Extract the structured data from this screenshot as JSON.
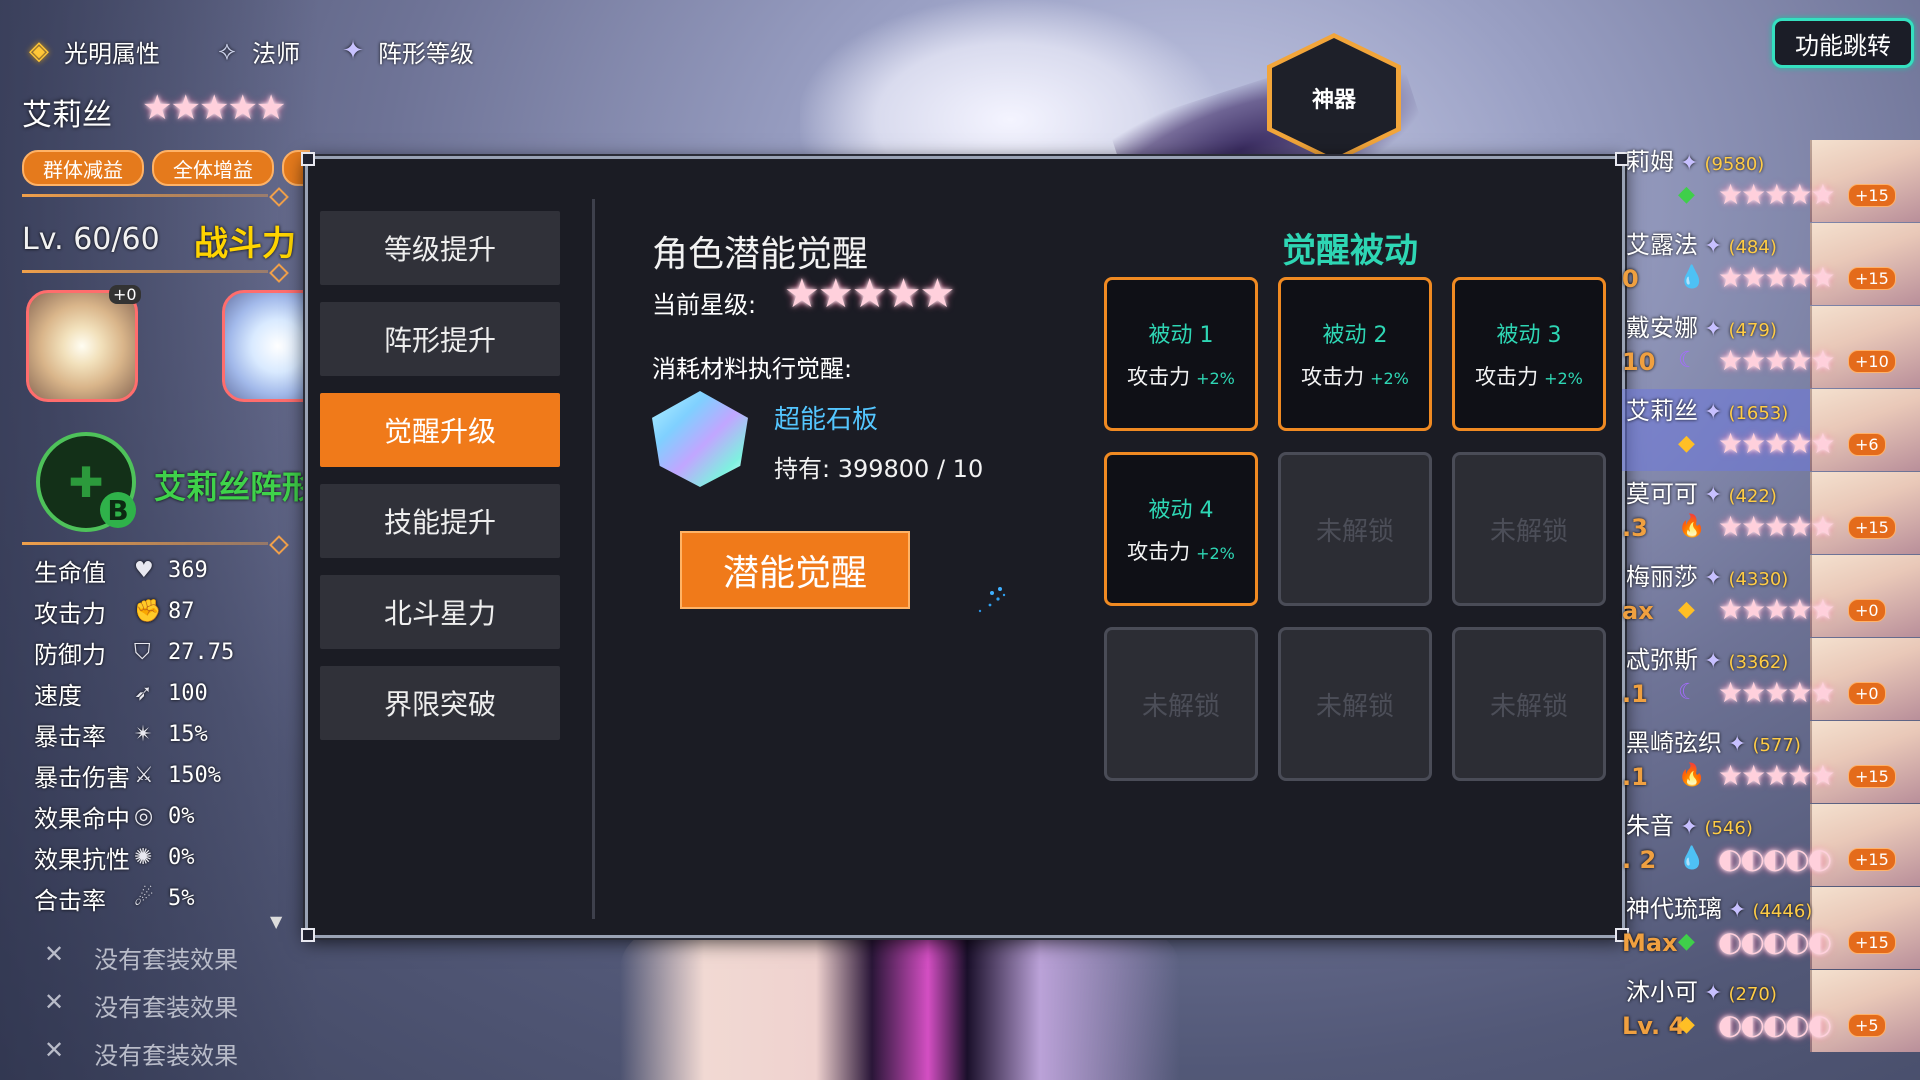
{
  "header": {
    "attribute_label": "光明属性",
    "class_label": "法师",
    "formation_label": "阵形等级",
    "switch_button": "功能跳转",
    "artifact_label": "神器"
  },
  "character": {
    "name": "艾莉丝",
    "stars": "★★★★★",
    "tags": [
      "群体减益",
      "全体增益"
    ],
    "level_text": "Lv. 60/60",
    "combat_label": "战斗力",
    "equip": [
      {
        "badge": "+0"
      },
      {
        "badge": ""
      }
    ],
    "formation_name": "艾莉丝阵形",
    "formation_grade": "B"
  },
  "stats": [
    {
      "label": "生命值",
      "icon": "heart-icon",
      "glyph": "♥",
      "value": "369"
    },
    {
      "label": "攻击力",
      "icon": "fist-icon",
      "glyph": "✊",
      "value": "87"
    },
    {
      "label": "防御力",
      "icon": "shield-icon",
      "glyph": "⛉",
      "value": "27.75"
    },
    {
      "label": "速度",
      "icon": "wing-icon",
      "glyph": "➶",
      "value": "100"
    },
    {
      "label": "暴击率",
      "icon": "crit-icon",
      "glyph": "✴",
      "value": "15%"
    },
    {
      "label": "暴击伤害",
      "icon": "crit-damage-icon",
      "glyph": "⚔",
      "value": "150%"
    },
    {
      "label": "效果命中",
      "icon": "target-icon",
      "glyph": "◎",
      "value": "0%"
    },
    {
      "label": "效果抗性",
      "icon": "resist-icon",
      "glyph": "✺",
      "value": "0%"
    },
    {
      "label": "合击率",
      "icon": "combo-icon",
      "glyph": "☄",
      "value": "5%"
    }
  ],
  "set_effects": [
    {
      "mark": "✕",
      "text": "没有套装效果"
    },
    {
      "mark": "✕",
      "text": "没有套装效果"
    },
    {
      "mark": "✕",
      "text": "没有套装效果"
    }
  ],
  "nav": [
    {
      "label": "等级提升",
      "active": false
    },
    {
      "label": "阵形提升",
      "active": false
    },
    {
      "label": "觉醒升级",
      "active": true
    },
    {
      "label": "技能提升",
      "active": false
    },
    {
      "label": "北斗星力",
      "active": false
    },
    {
      "label": "界限突破",
      "active": false
    }
  ],
  "awaken": {
    "title": "角色潜能觉醒",
    "current_star_label": "当前星级:",
    "current_stars": "★★★★★",
    "material_label": "消耗材料执行觉醒:",
    "material_name": "超能石板",
    "owned_text": "持有: 399800 / 10",
    "button": "潜能觉醒"
  },
  "passives": {
    "title": "觉醒被动",
    "cells": [
      {
        "name": "被动 1",
        "stat": "攻击力",
        "bonus": "+2%",
        "unlocked": true
      },
      {
        "name": "被动 2",
        "stat": "攻击力",
        "bonus": "+2%",
        "unlocked": true
      },
      {
        "name": "被动 3",
        "stat": "攻击力",
        "bonus": "+2%",
        "unlocked": true
      },
      {
        "name": "被动 4",
        "stat": "攻击力",
        "bonus": "+2%",
        "unlocked": true
      },
      {
        "locked_text": "未解锁",
        "unlocked": false
      },
      {
        "locked_text": "未解锁",
        "unlocked": false
      },
      {
        "locked_text": "未解锁",
        "unlocked": false
      },
      {
        "locked_text": "未解锁",
        "unlocked": false
      },
      {
        "locked_text": "未解锁",
        "unlocked": false
      }
    ]
  },
  "roster": [
    {
      "name": "莉姆",
      "power": "(9580)",
      "lv": "",
      "elem": "◆",
      "elem_color": "#3fcf4a",
      "stars": "★★★★★",
      "plus": "+15",
      "selected": false
    },
    {
      "name": "艾露法",
      "power": "(484)",
      "lv": "0",
      "elem": "💧",
      "elem_color": "#3a8cff",
      "stars": "★★★★★",
      "plus": "+15",
      "selected": false
    },
    {
      "name": "戴安娜",
      "power": "(479)",
      "lv": "10",
      "elem": "☾",
      "elem_color": "#a46bff",
      "stars": "★★★★★",
      "plus": "+10",
      "selected": false
    },
    {
      "name": "艾莉丝",
      "power": "(1653)",
      "lv": "",
      "elem": "◆",
      "elem_color": "#ffbf25",
      "stars": "★★★★★",
      "plus": "+6",
      "selected": true
    },
    {
      "name": "莫可可",
      "power": "(422)",
      "lv": ".3",
      "elem": "🔥",
      "elem_color": "#ff5a2a",
      "stars": "★★★★★",
      "plus": "+15",
      "selected": false
    },
    {
      "name": "梅丽莎",
      "power": "(4330)",
      "lv": "ax",
      "elem": "◆",
      "elem_color": "#ffbf25",
      "stars": "★★★★★",
      "plus": "+0",
      "selected": false
    },
    {
      "name": "忒弥斯",
      "power": "(3362)",
      "lv": ".1",
      "elem": "☾",
      "elem_color": "#a46bff",
      "stars": "★★★★★",
      "plus": "+0",
      "selected": false
    },
    {
      "name": "黑崎弦织",
      "power": "(577)",
      "lv": ".1",
      "elem": "🔥",
      "elem_color": "#ff5a2a",
      "stars": "★★★★★",
      "plus": "+15",
      "selected": false
    },
    {
      "name": "朱音",
      "power": "(546)",
      "lv": ". 2",
      "elem": "💧",
      "elem_color": "#3a8cff",
      "stars": "◐◐◐◐◐",
      "plus": "+15",
      "selected": false
    },
    {
      "name": "神代琉璃",
      "power": "(4446)",
      "lv": "Max",
      "elem": "◆",
      "elem_color": "#3fcf4a",
      "stars": "◐◐◐◐◐",
      "plus": "+15",
      "selected": false
    },
    {
      "name": "沐小可",
      "power": "(270)",
      "lv": "Lv. 4",
      "elem": "◆",
      "elem_color": "#ffbf25",
      "stars": "◐◐◐◐◐",
      "plus": "+5",
      "selected": false
    }
  ]
}
